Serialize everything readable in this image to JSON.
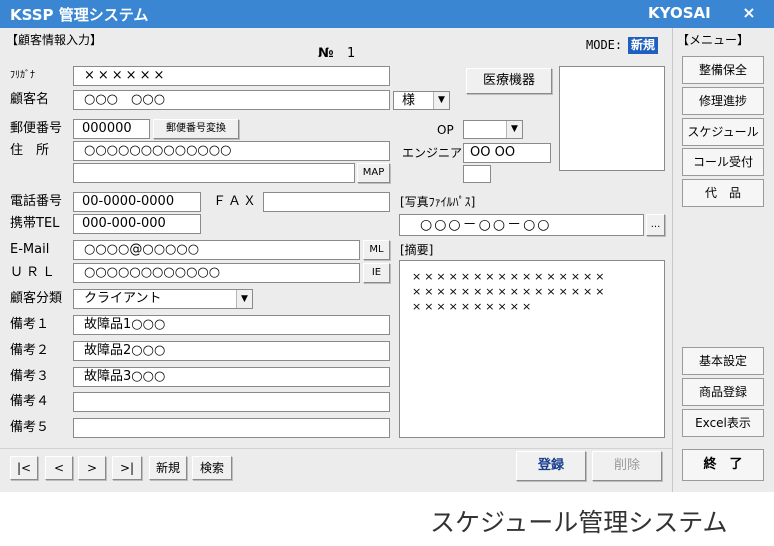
{
  "window": {
    "title": "KSSP 管理システム",
    "brand": "KYOSAI",
    "close_glyph": "×"
  },
  "form": {
    "section_title": "【顧客情報入力】",
    "record_no_label": "№",
    "record_no_value": "1",
    "mode_label": "MODE:",
    "mode_value": "新規"
  },
  "fields": {
    "furigana": {
      "label": "ﾌﾘｶﾞﾅ",
      "value": "××××××"
    },
    "customer_name": {
      "label": "顧客名",
      "value": "○○○　○○○",
      "honorific": "様"
    },
    "postal_code": {
      "label": "郵便番号",
      "value": "000000",
      "convert_button": "郵便番号変換"
    },
    "address": {
      "label": "住　所",
      "value": "○○○○○○○○○○○○○",
      "value2": "",
      "map_button": "MAP"
    },
    "phone": {
      "label": "電話番号",
      "value": "00-0000-0000"
    },
    "fax": {
      "label": "ＦＡＸ",
      "value": ""
    },
    "mobile": {
      "label": "携帯TEL",
      "value": "000-000-000"
    },
    "email": {
      "label": "E-Mail",
      "value": "○○○○@○○○○○",
      "mail_button": "ML"
    },
    "url": {
      "label": "ＵＲＬ",
      "value": "○○○○○○○○○○○○",
      "ie_button": "IE"
    },
    "category": {
      "label": "顧客分類",
      "value": "クライアント"
    },
    "notes": [
      {
        "label": "備考１",
        "value": "故障品1○○○"
      },
      {
        "label": "備考２",
        "value": "故障品2○○○"
      },
      {
        "label": "備考３",
        "value": "故障品3○○○"
      },
      {
        "label": "備考４",
        "value": ""
      },
      {
        "label": "備考５",
        "value": ""
      }
    ]
  },
  "right_panel": {
    "medical_button": "医療機器",
    "op_label": "OP",
    "op_value": "",
    "engineer_label": "エンジニア",
    "engineer_value": "OO OO",
    "photo_label": "[写真ﾌｧｲﾙﾊﾟｽ]",
    "photo_value": "○○○－○○－○○",
    "browse_button": "...",
    "summary_label": "[摘要]",
    "summary_lines": [
      "××××××××××××××××",
      "××××××××××××××××",
      "××××××××××"
    ]
  },
  "nav": {
    "first": "|<",
    "prev": "<",
    "next": ">",
    "last": ">|",
    "new": "新規",
    "search": "検索"
  },
  "actions": {
    "register": "登録",
    "delete": "削除"
  },
  "menu": {
    "title": "【メニュー】",
    "items": [
      "整備保全",
      "修理進捗",
      "スケジュール",
      "コール受付",
      "代　品"
    ],
    "bottom_items": [
      "基本設定",
      "商品登録",
      "Excel表示"
    ],
    "exit": "終　了"
  },
  "caption": "スケジュール管理システム",
  "colors": {
    "titlebar": "#3a86d3",
    "mode_badge": "#1f5fbf",
    "register_text": "#1a3f8f",
    "disabled_text": "#9a9a9a"
  }
}
